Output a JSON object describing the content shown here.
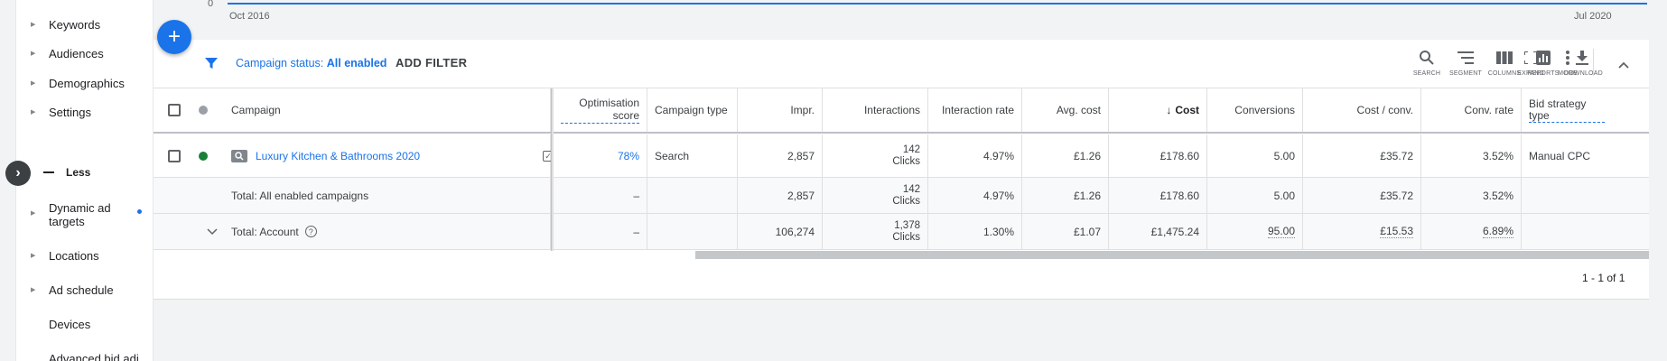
{
  "nav": {
    "items_top": [
      {
        "label": "Keywords"
      },
      {
        "label": "Audiences"
      },
      {
        "label": "Demographics"
      },
      {
        "label": "Settings"
      }
    ],
    "less_label": "Less",
    "items_bottom": [
      {
        "label": "Dynamic ad targets",
        "label_line1": "Dynamic ad",
        "label_line2": "targets",
        "has_dot": true
      },
      {
        "label": "Locations"
      },
      {
        "label": "Ad schedule"
      },
      {
        "label": "Devices"
      },
      {
        "label": "Advanced bid adj."
      }
    ]
  },
  "chart": {
    "y_zero": "0",
    "x_start": "Oct 2016",
    "x_end": "Jul 2020",
    "line_color": "#1a73e8"
  },
  "fab": {
    "symbol": "+"
  },
  "filter": {
    "prefix": "Campaign status:",
    "value": "All enabled",
    "add_label": "ADD FILTER",
    "icon": "filter-icon",
    "color": "#1a73e8"
  },
  "toolbar": {
    "search": "SEARCH",
    "segment": "SEGMENT",
    "columns": "COLUMNS",
    "reports": "REPORTS",
    "download": "DOWNLOAD",
    "expand": "EXPAND",
    "more": "MORE"
  },
  "table": {
    "headers": {
      "campaign": "Campaign",
      "optimisation_score": "Optimisation score",
      "campaign_type": "Campaign type",
      "impr": "Impr.",
      "interactions": "Interactions",
      "interaction_rate": "Interaction rate",
      "avg_cost": "Avg. cost",
      "cost": "Cost",
      "conversions": "Conversions",
      "cost_conv": "Cost / conv.",
      "conv_rate": "Conv. rate",
      "bid_strategy_line1": "Bid strategy",
      "bid_strategy_line2": "type"
    },
    "rows": [
      {
        "status_color": "#188038",
        "campaign": "Luxury Kitchen & Bathrooms 2020",
        "optimisation_score": "78%",
        "campaign_type": "Search",
        "impr": "2,857",
        "interactions": "142",
        "interactions_unit": "Clicks",
        "interaction_rate": "4.97%",
        "avg_cost": "£1.26",
        "cost": "£178.60",
        "conversions": "5.00",
        "cost_conv": "£35.72",
        "conv_rate": "3.52%",
        "bid_strategy": "Manual CPC"
      }
    ],
    "total_enabled": {
      "label": "Total: All enabled campaigns",
      "optimisation_score": "–",
      "impr": "2,857",
      "interactions": "142",
      "interactions_unit": "Clicks",
      "interaction_rate": "4.97%",
      "avg_cost": "£1.26",
      "cost": "£178.60",
      "conversions": "5.00",
      "cost_conv": "£35.72",
      "conv_rate": "3.52%"
    },
    "total_account": {
      "label": "Total: Account",
      "optimisation_score": "–",
      "impr": "106,274",
      "interactions": "1,378",
      "interactions_unit": "Clicks",
      "interaction_rate": "1.30%",
      "avg_cost": "£1.07",
      "cost": "£1,475.24",
      "conversions": "95.00",
      "cost_conv": "£15.53",
      "conv_rate": "6.89%"
    }
  },
  "pager": {
    "text": "1 - 1 of 1"
  }
}
